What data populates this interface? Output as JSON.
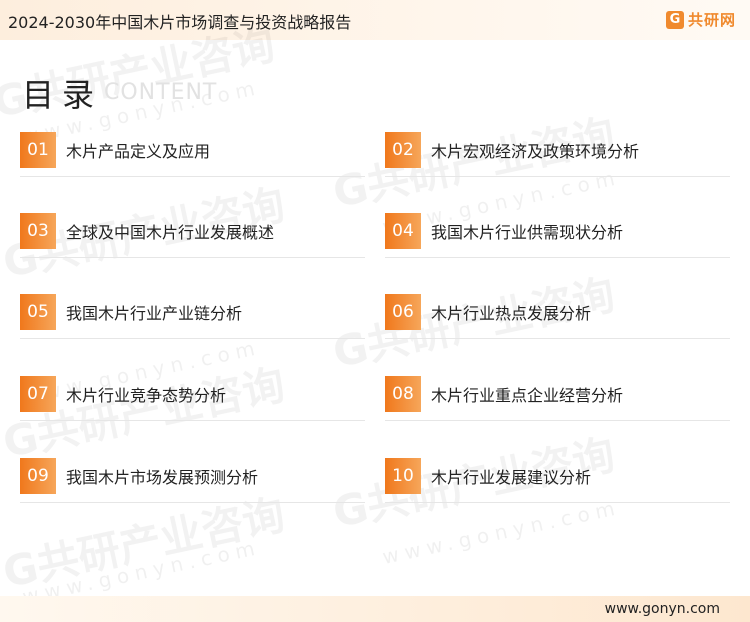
{
  "header": {
    "title": "2024-2030年中国木片市场调查与投资战略报告",
    "brand_icon": "G",
    "brand_name": "共研网"
  },
  "toc": {
    "title": "目录",
    "subtitle": "CONTENT",
    "items": [
      {
        "num": "01",
        "label": "木片产品定义及应用"
      },
      {
        "num": "02",
        "label": "木片宏观经济及政策环境分析"
      },
      {
        "num": "03",
        "label": "全球及中国木片行业发展概述"
      },
      {
        "num": "04",
        "label": "我国木片行业供需现状分析"
      },
      {
        "num": "05",
        "label": "我国木片行业产业链分析"
      },
      {
        "num": "06",
        "label": "木片行业热点发展分析"
      },
      {
        "num": "07",
        "label": "木片行业竞争态势分析"
      },
      {
        "num": "08",
        "label": "木片行业重点企业经营分析"
      },
      {
        "num": "09",
        "label": "我国木片市场发展预测分析"
      },
      {
        "num": "10",
        "label": "木片行业发展建议分析"
      }
    ]
  },
  "watermark": {
    "text": "G共研产业咨询",
    "url": "www.gonyn.com"
  },
  "footer": {
    "url": "www.gonyn.com"
  },
  "colors": {
    "accent": "#f0781c",
    "accent_light": "#f6a65a",
    "header_bg": "#fdeedd"
  }
}
